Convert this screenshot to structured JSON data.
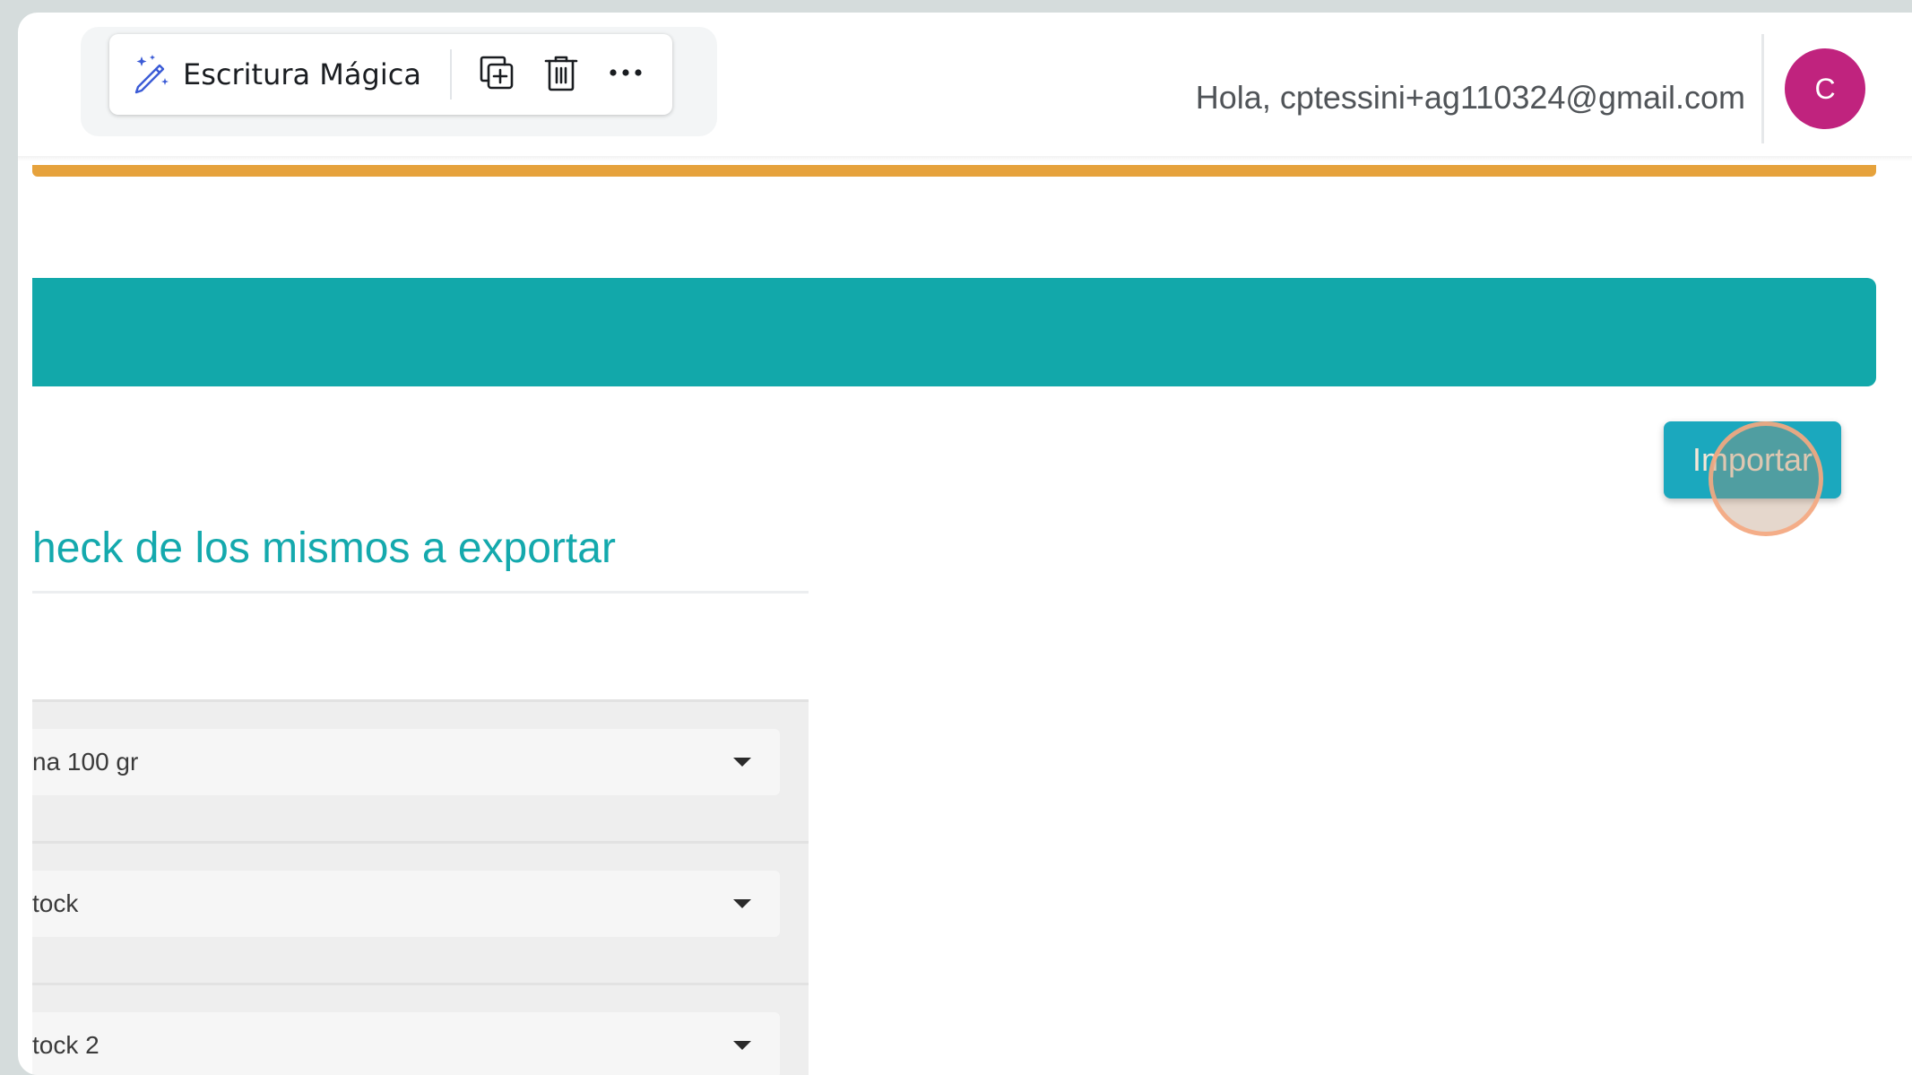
{
  "toolbar": {
    "magic_label": "Escritura Mágica",
    "magic_icon": "magic-pen-icon",
    "duplicate_icon": "duplicate-icon",
    "delete_icon": "trash-icon",
    "more_icon": "more-horizontal-icon"
  },
  "header": {
    "greeting": "Hola, cptessini+ag110324@gmail.com",
    "avatar_initial": "C",
    "avatar_color": "#c0237e"
  },
  "colors": {
    "accent_orange": "#e6a23c",
    "accent_teal": "#12a8aa",
    "button_teal": "#1ba8be"
  },
  "main": {
    "import_button_label": "Importar",
    "section_title": "heck de los mismos a exportar",
    "fields": [
      {
        "value": "na 100 gr"
      },
      {
        "value": "tock"
      },
      {
        "value": "tock 2"
      }
    ]
  }
}
